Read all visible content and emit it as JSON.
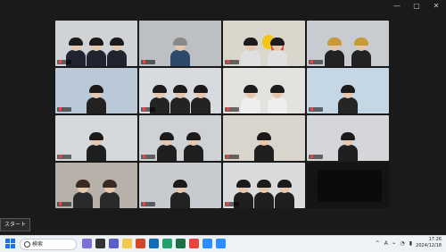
{
  "window": {
    "controls": [
      "—",
      "▢",
      "✕"
    ]
  },
  "tooltip": {
    "label": "スタート"
  },
  "taskbar": {
    "search_placeholder": "検索",
    "apps": [
      {
        "name": "widget-icon",
        "color": "#7c6fd6"
      },
      {
        "name": "taskview-icon",
        "color": "#333333"
      },
      {
        "name": "chat-icon",
        "color": "#5b5fc7"
      },
      {
        "name": "file-explorer-icon",
        "color": "#f2c94c"
      },
      {
        "name": "powerpoint-icon",
        "color": "#d24726"
      },
      {
        "name": "outlook-icon",
        "color": "#0f6cbd"
      },
      {
        "name": "edge-icon",
        "color": "#1fa36b"
      },
      {
        "name": "excel-icon",
        "color": "#1d7044"
      },
      {
        "name": "chrome-icon",
        "color": "#e8453c"
      },
      {
        "name": "zoom-icon",
        "color": "#2d8cff"
      },
      {
        "name": "zoom-icon-2",
        "color": "#2d8cff"
      }
    ],
    "tray": [
      "^",
      "A",
      "⌁",
      "◔",
      "▮"
    ],
    "time": "17:26",
    "date": "2024/12/18"
  },
  "tiles": [
    {
      "bg": "#cfd3d6",
      "people": 3,
      "hair": "#1c1a1a",
      "body": "#1f2430"
    },
    {
      "bg": "#bcc0c2",
      "people": 1,
      "hair": "#8a8a8a",
      "body": "#2d4a6b",
      "active": true
    },
    {
      "bg": "#d9d6cc",
      "people": 2,
      "hair": "#1c1a1a",
      "body": "#e0e0e0",
      "balloons": true
    },
    {
      "bg": "#c8cbcf",
      "people": 2,
      "hair": "#c79a3a",
      "body": "#222"
    },
    {
      "bg": "#b9c9d8",
      "people": 1,
      "hair": "#1c1a1a",
      "body": "#222"
    },
    {
      "bg": "#d7dbe0",
      "people": 3,
      "hair": "#1c1a1a",
      "body": "#232323"
    },
    {
      "bg": "#e4e2df",
      "people": 2,
      "hair": "#1c1a1a",
      "body": "#eeeeee"
    },
    {
      "bg": "#c5d7e4",
      "people": 1,
      "hair": "#1c1a1a",
      "body": "#252525"
    },
    {
      "bg": "#d5d8db",
      "people": 1,
      "hair": "#1c1a1a",
      "body": "#1f1f1f"
    },
    {
      "bg": "#cfd2d4",
      "people": 2,
      "hair": "#1c1a1a",
      "body": "#1f1f1f"
    },
    {
      "bg": "#d9d4cc",
      "people": 1,
      "hair": "#1c1a1a",
      "body": "#1f1f1f"
    },
    {
      "bg": "#d4d6d9",
      "people": 1,
      "hair": "#1c1a1a",
      "body": "#1f1f1f"
    },
    {
      "bg": "#b7b1a9",
      "people": 2,
      "hair": "#3a2a22",
      "body": "#2a2a2a"
    },
    {
      "bg": "#c7cbd0",
      "people": 1,
      "hair": "#1c1a1a",
      "body": "#222"
    },
    {
      "bg": "#d8dadc",
      "people": 3,
      "hair": "#1c1a1a",
      "body": "#1f1f1f"
    },
    {
      "bg": "#141414",
      "people": 0,
      "black": true
    }
  ]
}
